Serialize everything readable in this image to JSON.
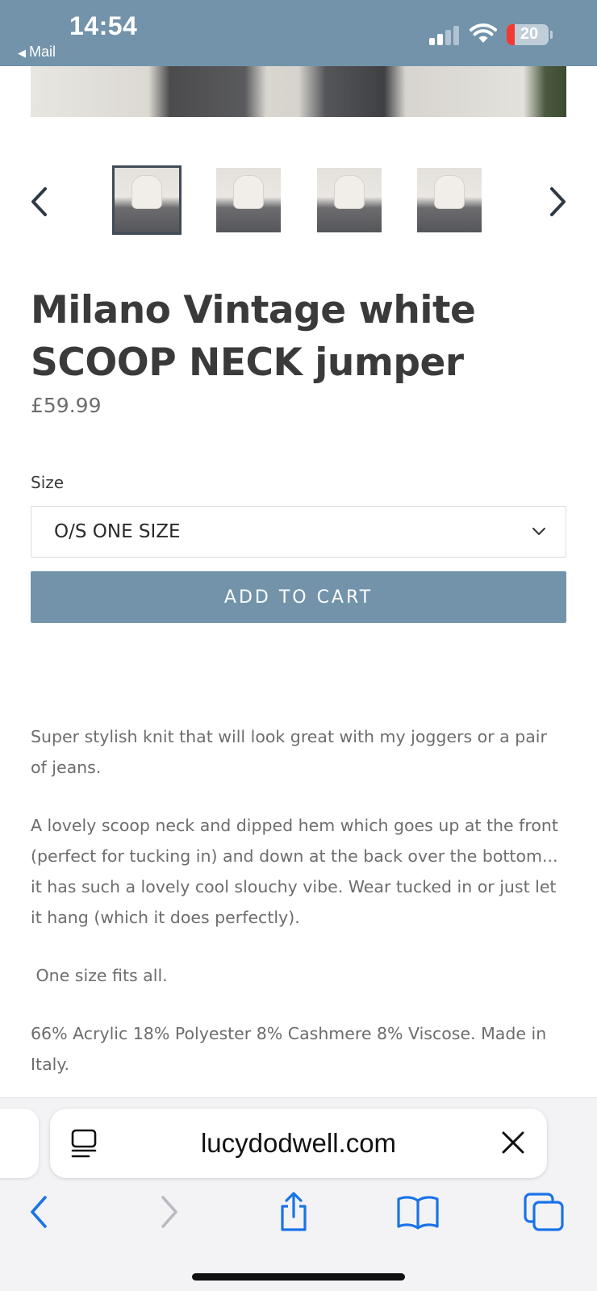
{
  "status_bar": {
    "time": "14:54",
    "back_label": "Mail",
    "battery": "20",
    "background_color": "#7293aa"
  },
  "gallery": {
    "prev_icon": "chevron-left-icon",
    "next_icon": "chevron-right-icon",
    "thumbnail_count": 4,
    "active_thumbnail": 1
  },
  "product": {
    "title": "Milano Vintage white SCOOP NECK jumper",
    "price": "£59.99",
    "size_label": "Size",
    "size_selected": "O/S ONE SIZE",
    "add_to_cart_label": "ADD TO CART",
    "accent_color": "#7293aa"
  },
  "description": [
    "Super stylish knit that will look great with my joggers or a pair of jeans.",
    "A lovely scoop neck and dipped hem which goes up at the front (perfect for tucking in) and down at the back over the bottom... it has such a lovely cool slouchy vibe. Wear tucked in or just let it hang (which it does perfectly).",
    " One size fits all.",
    "66% Acrylic 18% Polyester 8% Cashmere 8% Viscose. Made in Italy."
  ],
  "browser": {
    "url": "lucydodwell.com",
    "icons": [
      "reader-icon",
      "clear-icon",
      "back-icon",
      "forward-icon",
      "share-icon",
      "bookmarks-icon",
      "tabs-icon"
    ]
  }
}
